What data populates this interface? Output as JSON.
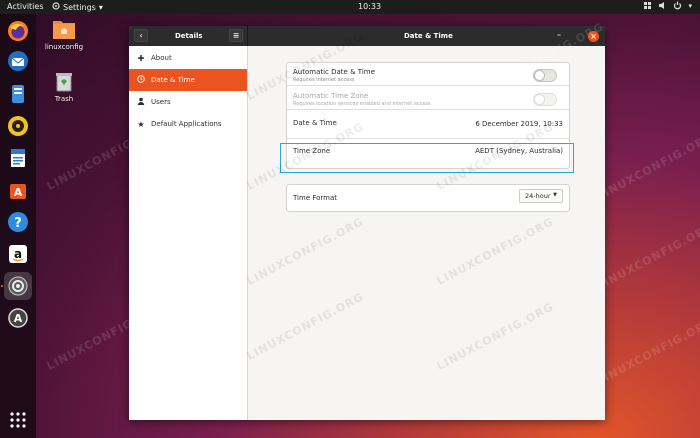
{
  "topbar": {
    "activities": "Activities",
    "app_menu": "Settings",
    "clock": "10:33"
  },
  "dock": {
    "items": [
      "firefox-icon",
      "thunderbird-icon",
      "files-icon",
      "rhythmbox-icon",
      "writer-icon",
      "software-icon",
      "help-icon",
      "amazon-icon",
      "settings-icon",
      "updater-icon",
      "show-apps-icon"
    ]
  },
  "desktop": {
    "icons": [
      {
        "label": "linuxconfig",
        "icon": "home-folder-icon"
      },
      {
        "label": "Trash",
        "icon": "trash-icon"
      }
    ]
  },
  "window": {
    "left_title": "Details",
    "main_title": "Date & Time",
    "sidebar": [
      {
        "label": "About",
        "icon": "plus-icon"
      },
      {
        "label": "Date & Time",
        "icon": "clock-icon"
      },
      {
        "label": "Users",
        "icon": "user-icon"
      },
      {
        "label": "Default Applications",
        "icon": "star-icon"
      }
    ],
    "auto_date_time": {
      "title": "Automatic Date & Time",
      "subtitle": "Requires internet access",
      "enabled": false
    },
    "auto_time_zone": {
      "title": "Automatic Time Zone",
      "subtitle": "Requires location services enabled and internet access",
      "enabled": false
    },
    "date_time": {
      "title": "Date & Time",
      "value": "6 December 2019, 10:33"
    },
    "time_zone": {
      "title": "Time Zone",
      "value": "AEDT (Sydney, Australia)"
    },
    "time_format": {
      "title": "Time Format",
      "value": "24-hour"
    }
  },
  "watermark": "LINUXCONFIG.ORG",
  "colors": {
    "accent": "#e95420",
    "highlight": "#29a7e0"
  }
}
